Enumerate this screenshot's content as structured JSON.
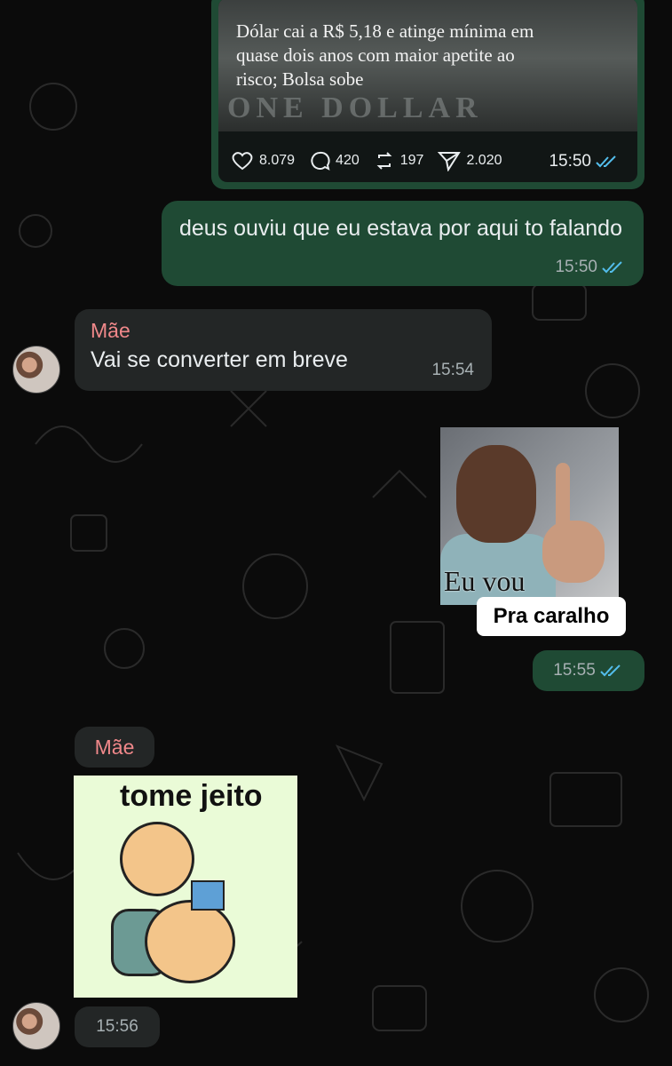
{
  "card": {
    "headline": "Dólar cai a R$ 5,18 e atinge mínima em quase dois anos com maior apetite ao risco; Bolsa sobe",
    "bill_text": "ONE DOLLAR",
    "likes": "8.079",
    "comments": "420",
    "reposts": "197",
    "shares": "2.020",
    "time": "15:50"
  },
  "messages": [
    {
      "text": "deus ouviu que eu estava por aqui to falando",
      "time": "15:50"
    },
    {
      "sender": "Mãe",
      "text": "Vai se converter em breve",
      "time": "15:54"
    }
  ],
  "sticker1": {
    "overlay": "Eu vou",
    "label": "Pra caralho",
    "time": "15:55"
  },
  "sticker2": {
    "sender": "Mãe",
    "caption": "tome jeito",
    "time": "15:56"
  },
  "colors": {
    "outgoing": "#1f4a34",
    "incoming": "#232626",
    "sender_name": "#f0888a",
    "read_ticks": "#53bdeb"
  }
}
